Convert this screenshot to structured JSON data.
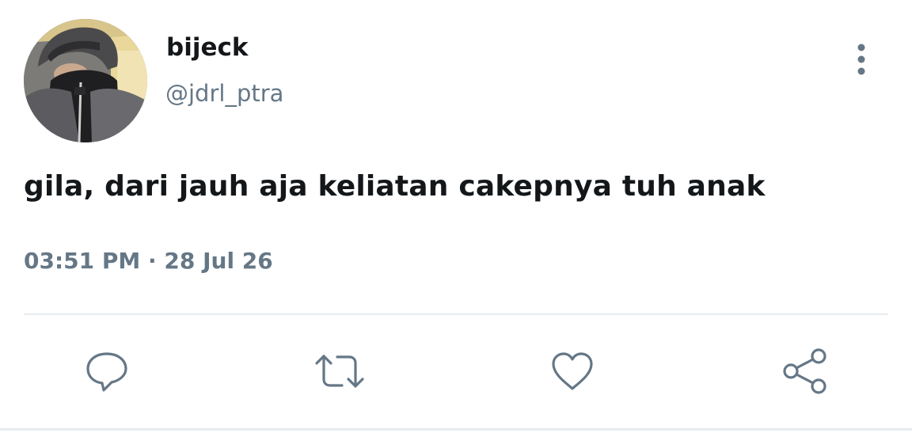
{
  "tweet": {
    "author": {
      "display_name": "bijeck",
      "handle": "@jdrl_ptra"
    },
    "text": "gila, dari jauh aja keliatan cakepnya tuh anak",
    "timestamp": "03:51 PM · 28 Jul 26"
  },
  "actions": [
    {
      "icon": "reply-icon"
    },
    {
      "icon": "retweet-icon"
    },
    {
      "icon": "like-icon"
    },
    {
      "icon": "share-icon"
    }
  ],
  "menu": {
    "icon": "more-vertical-icon"
  },
  "colors": {
    "text_primary": "#14171a",
    "text_secondary": "#657786",
    "icon": "#657786",
    "divider": "#e6ecf0"
  }
}
